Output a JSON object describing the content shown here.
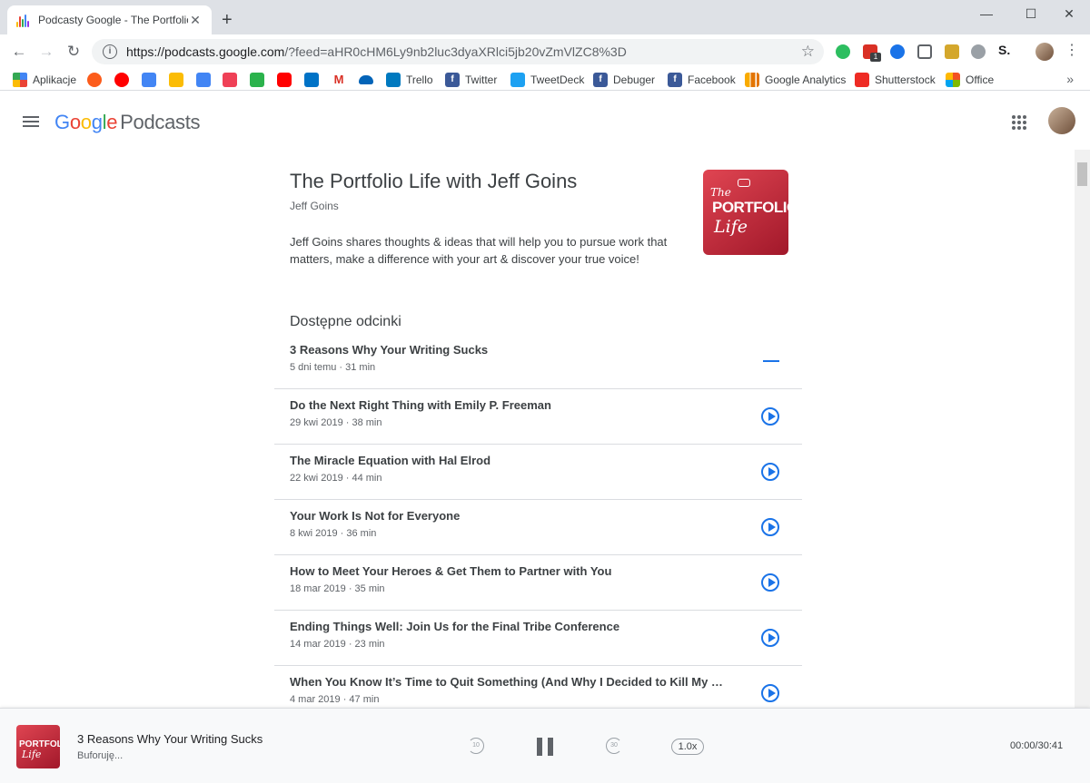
{
  "browser": {
    "tab_title": "Podcasty Google - The Portfolio L",
    "url_host": "https://podcasts.google.com",
    "url_rest": "/?feed=aHR0cHM6Ly9nb2luc3dyaXRlci5jb20vZmVlZC8%3D",
    "extension_badge": "1"
  },
  "bookmarks": {
    "apps_label": "Aplikacje",
    "items": [
      "Trello",
      "Twitter",
      "TweetDeck",
      "Debuger",
      "Facebook",
      "Google Analytics",
      "Shutterstock",
      "Office"
    ],
    "more": "»"
  },
  "app": {
    "logo_google": [
      "G",
      "o",
      "o",
      "g",
      "l",
      "e"
    ],
    "logo_product": "Podcasts"
  },
  "podcast": {
    "title": "The Portfolio Life with Jeff Goins",
    "author": "Jeff Goins",
    "description": "Jeff Goins shares thoughts & ideas that will help you to pursue work that matters, make a difference with your art & discover your true voice!",
    "cover_text": [
      "The",
      "PORTFOLIO",
      "Life"
    ],
    "section_title": "Dostępne odcinki"
  },
  "episodes": [
    {
      "title": "3 Reasons Why Your Writing Sucks",
      "meta": "5 dni temu · 31 min"
    },
    {
      "title": "Do the Next Right Thing with Emily P. Freeman",
      "meta": "29 kwi 2019 · 38 min"
    },
    {
      "title": "The Miracle Equation with Hal Elrod",
      "meta": "22 kwi 2019 · 44 min"
    },
    {
      "title": "Your Work Is Not for Everyone",
      "meta": "8 kwi 2019 · 36 min"
    },
    {
      "title": "How to Meet Your Heroes & Get Them to Partner with You",
      "meta": "18 mar 2019 · 35 min"
    },
    {
      "title": "Ending Things Well: Join Us for the Final Tribe Conference",
      "meta": "14 mar 2019 · 23 min"
    },
    {
      "title": "When You Know It’s Time to Quit Something (And Why I Decided to Kill My Co...",
      "meta": "4 mar 2019 · 47 min"
    }
  ],
  "player": {
    "title": "3 Reasons Why Your Writing Sucks",
    "status": "Buforuję...",
    "rewind_label": "10",
    "forward_label": "30",
    "speed": "1.0x",
    "time": "00:00/30:41"
  },
  "colors": {
    "accent": "#1a73e8",
    "cover_red": "#c8283a"
  }
}
